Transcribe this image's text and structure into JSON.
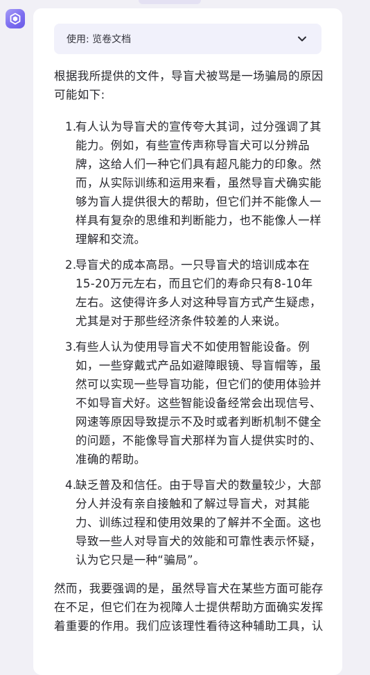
{
  "document_selector": {
    "label": "使用: 览卷文档"
  },
  "answer": {
    "intro": "根据我所提供的文件，导盲犬被骂是一场骗局的原因可能如下:",
    "points": [
      {
        "number": "1.",
        "text": "有人认为导盲犬的宣传夸大其词，过分强调了其能力。例如，有些宣传声称导盲犬可以分辨品牌，这给人们一种它们具有超凡能力的印象。然而，从实际训练和运用来看，虽然导盲犬确实能够为盲人提供很大的帮助，但它们并不能像人一样具有复杂的思维和判断能力，也不能像人一样理解和交流。"
      },
      {
        "number": "2.",
        "text": "导盲犬的成本高昂。一只导盲犬的培训成本在15-20万元左右，而且它们的寿命只有8-10年左右。这使得许多人对这种导盲方式产生疑虑，尤其是对于那些经济条件较差的人来说。"
      },
      {
        "number": "3.",
        "text": "有些人认为使用导盲犬不如使用智能设备。例如，一些穿戴式产品如避障眼镜、导盲帽等，虽然可以实现一些导盲功能，但它们的使用体验并不如导盲犬好。这些智能设备经常会出现信号、网速等原因导致提示不及时或者判断机制不健全的问题，不能像导盲犬那样为盲人提供实时的、准确的帮助。"
      },
      {
        "number": "4.",
        "text": "缺乏普及和信任。由于导盲犬的数量较少，大部分人并没有亲自接触和了解过导盲犬，对其能力、训练过程和使用效果的了解并不全面。这也导致一些人对导盲犬的效能和可靠性表示怀疑，认为它只是一种“骗局”。"
      }
    ],
    "outro": "然而，我要强调的是，虽然导盲犬在某些方面可能存在不足，但它们在为视障人士提供帮助方面确实发挥着重要的作用。我们应该理性看待这种辅助工具，认"
  },
  "icons": {
    "avatar": "bot-cube-icon",
    "dropdown": "chevron-down-icon"
  },
  "colors": {
    "accent": "#7c6df0",
    "card": "#ffffff",
    "page_background": "#f1f0f6",
    "selector_background": "#f1f1fb",
    "text": "#26262c"
  }
}
